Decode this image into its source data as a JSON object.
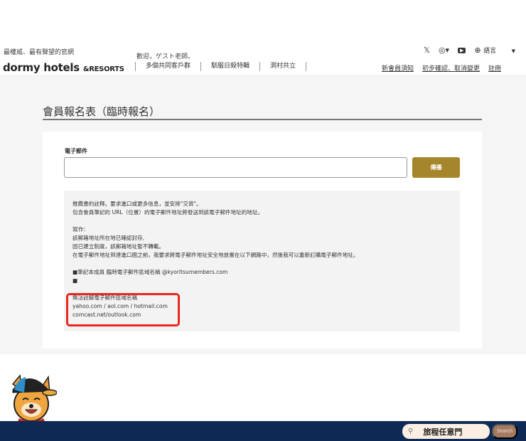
{
  "header": {
    "tagline": "最權威、最有聲望的官網",
    "logo_main": "dormy hotels",
    "logo_suffix": "&RESORTS",
    "welcome": "歡迎，ゲスト老師。",
    "nav": [
      "多個共同客戶群",
      "馴服日殺特輯",
      "洞村共立"
    ],
    "language": "語言",
    "links": [
      "新會員須知",
      "初步確認、取消變更",
      "註冊"
    ]
  },
  "page": {
    "title": "會員報名表（臨時報名）",
    "email_label": "電子郵件",
    "email_value": "",
    "send_label": "傳播",
    "notice": [
      "推薦書的註釋。要求進口或更多信息，並安排\"交貨\"。",
      "包含會員筆記的 URL（位置）的電子郵件地址將發送到該電子郵件地址的地址。",
      "",
      "寫作：",
      "該郵箱地址所在地已確認封存,",
      "因已建立制度，該郵箱地址暫不轉載。",
      "在電子郵件地址到達進口國之前，我要求將電子郵件地址安全地放置在以下網路中，然後我可以重新訂購電子郵件地址。",
      "",
      "■筆記本成員 臨時電子郵件區域名稱 @kyoritsumembers.com",
      "■",
      "",
      "無法註解電子郵件區域名稱",
      "yahoo.com / aol.com / hotmail.com",
      "comcast.net/outlook.com"
    ]
  },
  "footer": {
    "search_value": "旅程任意門",
    "search_button": "Search"
  },
  "colors": {
    "accent": "#a5862c",
    "footer": "#0d2a55",
    "highlight": "#e8281e"
  }
}
